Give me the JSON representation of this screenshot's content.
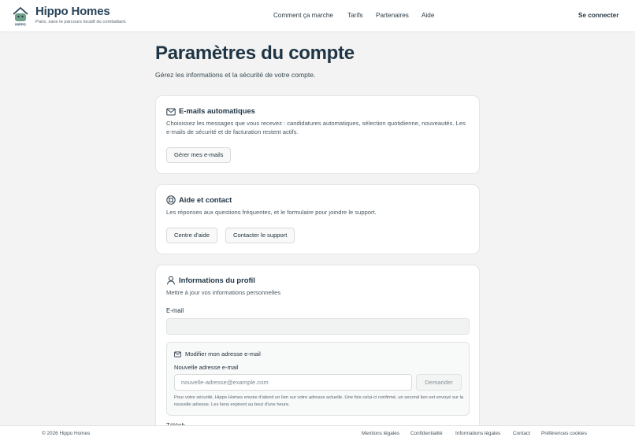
{
  "header": {
    "brand_name": "Hippo Homes",
    "brand_tagline": "Paris, sans le parcours locatif du combattant.",
    "nav": [
      "Comment ça marche",
      "Tarifs",
      "Partenaires",
      "Aide"
    ],
    "login_label": "Se connecter"
  },
  "page": {
    "title": "Paramètres du compte",
    "subtitle": "Gérez les informations et la sécurité de votre compte."
  },
  "emails_card": {
    "icon": "envelope-icon",
    "title": "E-mails automatiques",
    "description": "Choisissez les messages que vous recevez : candidatures automatiques, sélection quotidienne, nouveautés. Les e-mails de sécurité et de facturation restent actifs.",
    "button_label": "Gérer mes e-mails"
  },
  "help_card": {
    "icon": "help-circle-icon",
    "title": "Aide et contact",
    "description": "Les réponses aux questions fréquentes, et le formulaire pour joindre le support.",
    "button_help": "Centre d'aide",
    "button_contact": "Contacter le support"
  },
  "profile_card": {
    "icon": "user-icon",
    "title": "Informations du profil",
    "description": "Mettre à jour vos informations personnelles",
    "email_label": "E-mail",
    "email_value": "",
    "change_email": {
      "title": "Modifier mon adresse e-mail",
      "field_label": "Nouvelle adresse e-mail",
      "placeholder": "nouvelle-adresse@example.com",
      "button_label": "Demander",
      "note": "Pour votre sécurité, Hippo Homes envoie d'abord un lien sur votre adresse actuelle. Une fois celui-ci confirmé, un second lien est envoyé sur la nouvelle adresse. Les liens expirent au bout d'une heure."
    },
    "next_label_partial": "Téléph"
  },
  "footer": {
    "copyright": "© 2026 Hippo Homes",
    "links": [
      "Mentions légales",
      "Confidentialité",
      "Informations légales",
      "Contact",
      "Préférences cookies"
    ]
  },
  "colors": {
    "brand": "#28445a",
    "background": "#f2f3f2",
    "card": "#ffffff"
  }
}
